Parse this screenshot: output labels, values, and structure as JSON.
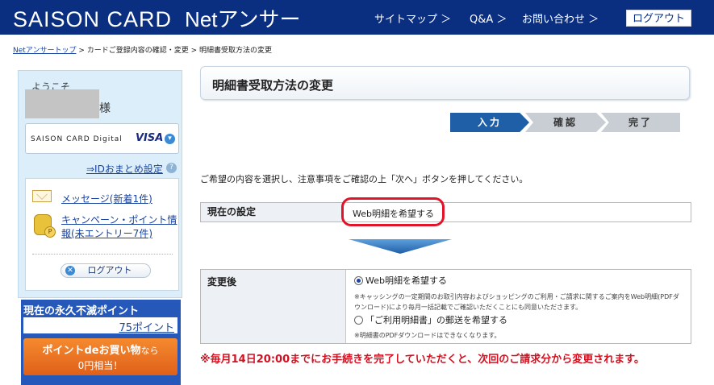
{
  "header": {
    "logo": "SAISON CARD",
    "logo_sub": "Netアンサー",
    "nav": [
      {
        "label": "サイトマップ ＞"
      },
      {
        "label": "Q&A ＞"
      },
      {
        "label": "お問い合わせ ＞"
      }
    ],
    "logout": "ログアウト"
  },
  "breadcrumb": {
    "home": "Netアンサートップ",
    "rest": " > カードご登録内容の確認・変更 > 明細書受取方法の変更"
  },
  "sidebar": {
    "welcome": "ようこそ",
    "sama": "様",
    "card_name": "SAISON CARD Digital",
    "card_brand": "VISA",
    "id_link": "⇒IDおまとめ設定",
    "help": "?",
    "message_link": "メッセージ(新着1件)",
    "campaign_link": "キャンペーン・ポイント情報(未エントリー7件)",
    "logout": "ログアウト",
    "points_title": "現在の永久不滅ポイント",
    "points_value": "75ポイント",
    "shop_title": "ポイントdeお買い物",
    "shop_title_small": "なら",
    "shop_sub": "0円相当！"
  },
  "main": {
    "page_title": "明細書受取方法の変更",
    "steps": [
      "入力",
      "確認",
      "完了"
    ],
    "instruction": "ご希望の内容を選択し、注意事項をご確認の上「次へ」ボタンを押してください。",
    "current_label": "現在の設定",
    "current_value": "Web明細を希望する",
    "new_label": "変更後",
    "option1": "Web明細を希望する",
    "option1_note": "※キャッシングの一定期間のお取引内容およびショッピングのご利用・ご請求に関するご案内をWeb明細(PDFダウンロード)により毎月一括記載でご確認いただくことにも同意いたださます。",
    "option2": "「ご利用明細書」の郵送を希望する",
    "option2_note": "※明細書のPDFダウンロードはできなくなります。",
    "warning": "※毎月14日20:00までにお手続きを完了していただくと、次回のご請求分から変更されます。"
  },
  "colors": {
    "header_bg": "#0b2f80",
    "step_active": "#1f5fa8",
    "warning": "#d41020",
    "highlight": "#e2142a"
  }
}
